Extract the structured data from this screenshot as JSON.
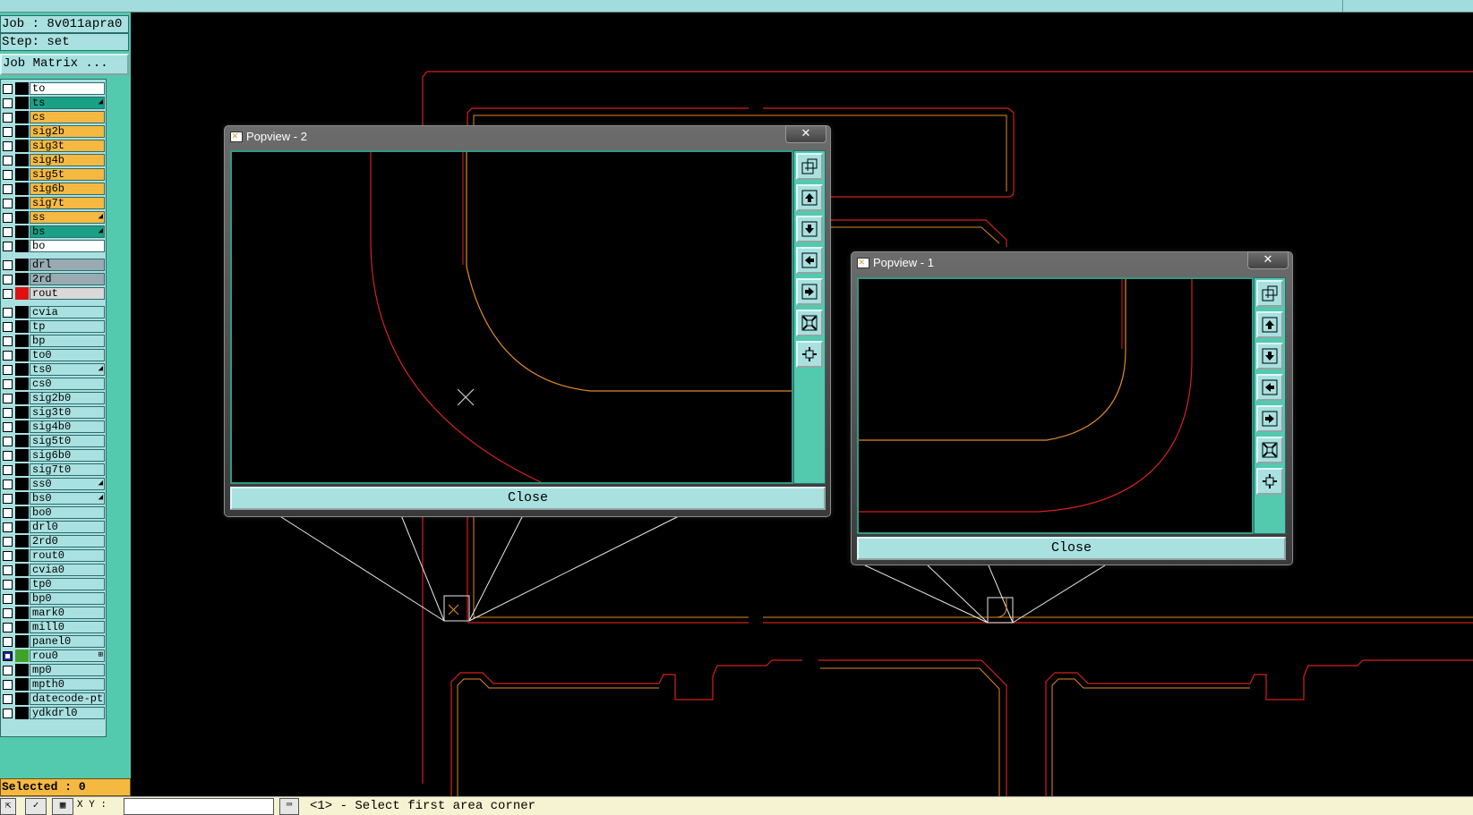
{
  "sidebar": {
    "job_label": "Job : 8v011apra0",
    "step_label": "Step: set",
    "job_matrix_button": "Job Matrix ...",
    "selected_label": "Selected : 0"
  },
  "layers": [
    {
      "name": "to",
      "color": "#ffffff"
    },
    {
      "name": "ts",
      "color": "#1aa085",
      "mark": "◢"
    },
    {
      "name": "cs",
      "color": "#f5b942"
    },
    {
      "name": "sig2b",
      "color": "#f5b942"
    },
    {
      "name": "sig3t",
      "color": "#f5b942"
    },
    {
      "name": "sig4b",
      "color": "#f5b942"
    },
    {
      "name": "sig5t",
      "color": "#f5b942"
    },
    {
      "name": "sig6b",
      "color": "#f5b942"
    },
    {
      "name": "sig7t",
      "color": "#f5b942"
    },
    {
      "name": "ss",
      "color": "#f5b942",
      "mark": "◢"
    },
    {
      "name": "bs",
      "color": "#1aa085",
      "mark": "◢"
    },
    {
      "name": "bo",
      "color": "#ffffff"
    },
    {
      "name": "drl",
      "color": "#9aaab2"
    },
    {
      "name": "2rd",
      "color": "#9aaab2"
    },
    {
      "name": "rout",
      "color": "#d9d9d9",
      "swatch": "#e01010"
    },
    {
      "name": "cvia",
      "color": "#a9e0e0"
    },
    {
      "name": "tp",
      "color": "#a9e0e0"
    },
    {
      "name": "bp",
      "color": "#a9e0e0"
    },
    {
      "name": "to0",
      "color": "#a9e0e0"
    },
    {
      "name": "ts0",
      "color": "#a9e0e0",
      "mark": "◢"
    },
    {
      "name": "cs0",
      "color": "#a9e0e0"
    },
    {
      "name": "sig2b0",
      "color": "#a9e0e0"
    },
    {
      "name": "sig3t0",
      "color": "#a9e0e0"
    },
    {
      "name": "sig4b0",
      "color": "#a9e0e0"
    },
    {
      "name": "sig5t0",
      "color": "#a9e0e0"
    },
    {
      "name": "sig6b0",
      "color": "#a9e0e0"
    },
    {
      "name": "sig7t0",
      "color": "#a9e0e0"
    },
    {
      "name": "ss0",
      "color": "#a9e0e0",
      "mark": "◢"
    },
    {
      "name": "bs0",
      "color": "#a9e0e0",
      "mark": "◢"
    },
    {
      "name": "bo0",
      "color": "#a9e0e0"
    },
    {
      "name": "drl0",
      "color": "#a9e0e0"
    },
    {
      "name": "2rd0",
      "color": "#a9e0e0"
    },
    {
      "name": "rout0",
      "color": "#a9e0e0"
    },
    {
      "name": "cvia0",
      "color": "#a9e0e0"
    },
    {
      "name": "tp0",
      "color": "#a9e0e0"
    },
    {
      "name": "bp0",
      "color": "#a9e0e0"
    },
    {
      "name": "mark0",
      "color": "#a9e0e0"
    },
    {
      "name": "mill0",
      "color": "#a9e0e0"
    },
    {
      "name": "panel0",
      "color": "#a9e0e0"
    },
    {
      "name": "rou0",
      "color": "#a9e0e0",
      "swatch": "#3fa32a",
      "checked": true,
      "mark": "⊞"
    },
    {
      "name": "mp0",
      "color": "#a9e0e0"
    },
    {
      "name": "mpth0",
      "color": "#a9e0e0"
    },
    {
      "name": "datecode-pte",
      "color": "#a9e0e0"
    },
    {
      "name": "ydkdrl0",
      "color": "#a9e0e0"
    }
  ],
  "popview2": {
    "title": "Popview - 2",
    "close_label": "Close"
  },
  "popview1": {
    "title": "Popview - 1",
    "close_label": "Close"
  },
  "toolbar_icons": [
    "zoom-home-icon",
    "pan-up-icon",
    "pan-down-icon",
    "pan-left-icon",
    "pan-right-icon",
    "zoom-in-icon",
    "zoom-out-icon"
  ],
  "statusbar": {
    "xy_label": "X Y :",
    "message": "<1> - Select first area corner"
  },
  "colors": {
    "profile_red": "#d42020",
    "route_orange": "#e08a2a",
    "panel_bg": "#53c9ae",
    "button_bg": "#a9e0e0",
    "selected_bg": "#f5b942"
  }
}
